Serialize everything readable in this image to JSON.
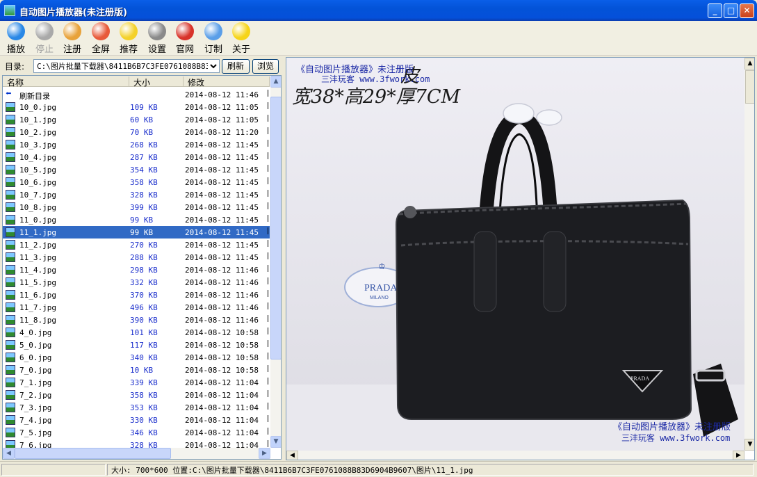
{
  "window": {
    "title": "自动图片播放器(未注册版)",
    "minimize": "_",
    "maximize": "□",
    "close": "✕"
  },
  "toolbar": [
    {
      "label": "播放",
      "icon": "play-icon",
      "color": "#2a88e6",
      "enabled": true
    },
    {
      "label": "停止",
      "icon": "stop-icon",
      "color": "#a9a9a9",
      "enabled": false
    },
    {
      "label": "注册",
      "icon": "register-icon",
      "color": "#e8a23a",
      "enabled": true
    },
    {
      "label": "全屏",
      "icon": "fullscreen-icon",
      "color": "#e85a3a",
      "enabled": true
    },
    {
      "label": "推荐",
      "icon": "star-icon",
      "color": "#f4d12a",
      "enabled": true
    },
    {
      "label": "设置",
      "icon": "settings-tools-icon",
      "color": "#8a8a8a",
      "enabled": true
    },
    {
      "label": "官网",
      "icon": "home-icon",
      "color": "#d8332a",
      "enabled": true
    },
    {
      "label": "订制",
      "icon": "users-icon",
      "color": "#5a9ee8",
      "enabled": true
    },
    {
      "label": "关于",
      "icon": "smiley-icon",
      "color": "#f6d419",
      "enabled": true
    }
  ],
  "directory": {
    "label": "目录:",
    "path": "C:\\图片批量下载器\\8411B6B7C3FE0761088B83I",
    "refresh_button": "刷新",
    "browse_button": "浏览"
  },
  "filelist": {
    "columns": {
      "name": "名称",
      "size": "大小",
      "modified": "修改"
    },
    "selected_index": 11,
    "rows": [
      {
        "name": "刷新目录",
        "size": "",
        "modified": "2014-08-12 11:46",
        "icon": "refresh-arrow-icon"
      },
      {
        "name": "10_0.jpg",
        "size": "109 KB",
        "modified": "2014-08-12 11:05"
      },
      {
        "name": "10_1.jpg",
        "size": "60 KB",
        "modified": "2014-08-12 11:05"
      },
      {
        "name": "10_2.jpg",
        "size": "70 KB",
        "modified": "2014-08-12 11:20"
      },
      {
        "name": "10_3.jpg",
        "size": "268 KB",
        "modified": "2014-08-12 11:45"
      },
      {
        "name": "10_4.jpg",
        "size": "287 KB",
        "modified": "2014-08-12 11:45"
      },
      {
        "name": "10_5.jpg",
        "size": "354 KB",
        "modified": "2014-08-12 11:45"
      },
      {
        "name": "10_6.jpg",
        "size": "358 KB",
        "modified": "2014-08-12 11:45"
      },
      {
        "name": "10_7.jpg",
        "size": "328 KB",
        "modified": "2014-08-12 11:45"
      },
      {
        "name": "10_8.jpg",
        "size": "399 KB",
        "modified": "2014-08-12 11:45"
      },
      {
        "name": "11_0.jpg",
        "size": "99 KB",
        "modified": "2014-08-12 11:45"
      },
      {
        "name": "11_1.jpg",
        "size": "99 KB",
        "modified": "2014-08-12 11:45"
      },
      {
        "name": "11_2.jpg",
        "size": "270 KB",
        "modified": "2014-08-12 11:45"
      },
      {
        "name": "11_3.jpg",
        "size": "288 KB",
        "modified": "2014-08-12 11:45"
      },
      {
        "name": "11_4.jpg",
        "size": "298 KB",
        "modified": "2014-08-12 11:46"
      },
      {
        "name": "11_5.jpg",
        "size": "332 KB",
        "modified": "2014-08-12 11:46"
      },
      {
        "name": "11_6.jpg",
        "size": "370 KB",
        "modified": "2014-08-12 11:46"
      },
      {
        "name": "11_7.jpg",
        "size": "496 KB",
        "modified": "2014-08-12 11:46"
      },
      {
        "name": "11_8.jpg",
        "size": "390 KB",
        "modified": "2014-08-12 11:46"
      },
      {
        "name": "4_0.jpg",
        "size": "101 KB",
        "modified": "2014-08-12 10:58"
      },
      {
        "name": "5_0.jpg",
        "size": "117 KB",
        "modified": "2014-08-12 10:58"
      },
      {
        "name": "6_0.jpg",
        "size": "340 KB",
        "modified": "2014-08-12 10:58"
      },
      {
        "name": "7_0.jpg",
        "size": "10 KB",
        "modified": "2014-08-12 10:58"
      },
      {
        "name": "7_1.jpg",
        "size": "339 KB",
        "modified": "2014-08-12 11:04"
      },
      {
        "name": "7_2.jpg",
        "size": "358 KB",
        "modified": "2014-08-12 11:04"
      },
      {
        "name": "7_3.jpg",
        "size": "353 KB",
        "modified": "2014-08-12 11:04"
      },
      {
        "name": "7_4.jpg",
        "size": "330 KB",
        "modified": "2014-08-12 11:04"
      },
      {
        "name": "7_5.jpg",
        "size": "346 KB",
        "modified": "2014-08-12 11:04"
      },
      {
        "name": "7_6.jpg",
        "size": "328 KB",
        "modified": "2014-08-12 11:04"
      }
    ]
  },
  "viewer": {
    "watermark_top_title": "《自动图片播放器》未注册版",
    "watermark_top_site": "三沣玩客 www.3fwork.com",
    "caption_line1_tail": "皮",
    "caption_line2": "宽38*高29*厚7CM",
    "watermark_bottom_title": "《自动图片播放器》未注册版",
    "watermark_bottom_site": "三沣玩客 www.3fwork.com",
    "logo_text": "PRADA",
    "logo_subtext": "MILANO",
    "plate_text": "PRADA"
  },
  "status": {
    "text": "大小: 700*600 位置:C:\\图片批量下载器\\8411B6B7C3FE0761088B83D6904B9607\\图片\\11_1.jpg"
  }
}
